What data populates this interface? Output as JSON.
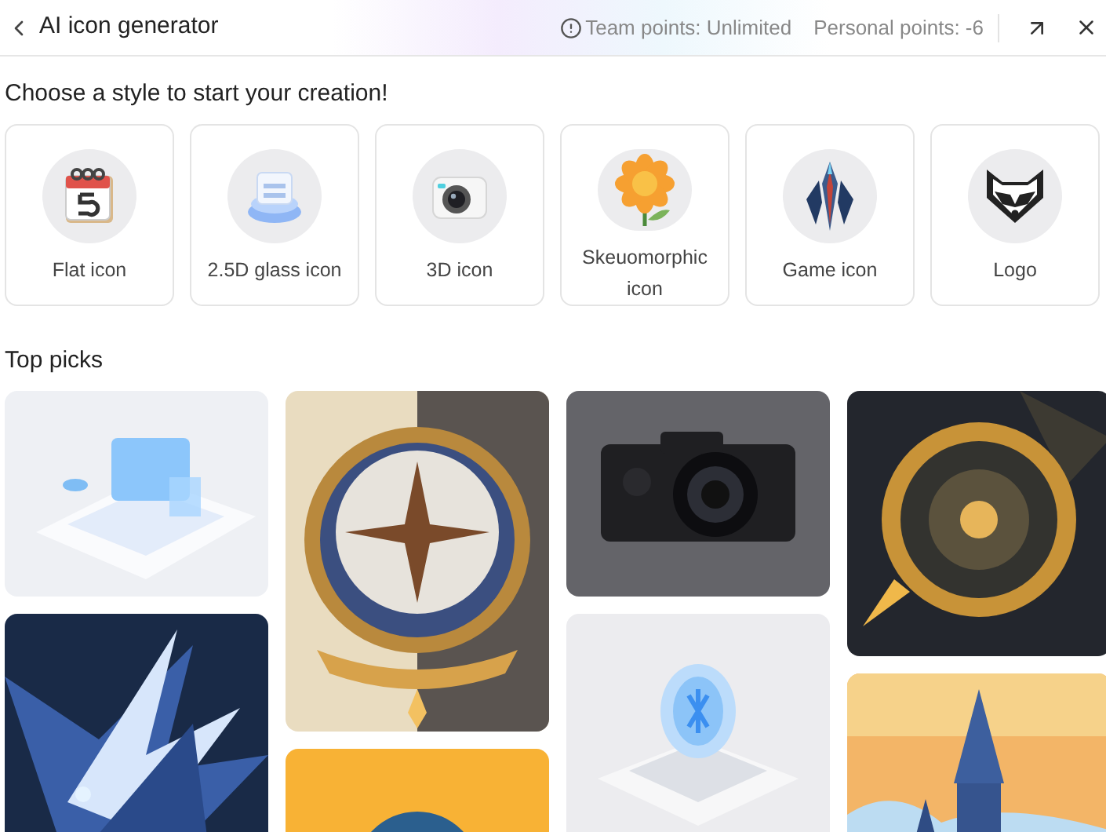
{
  "header": {
    "title": "AI icon generator",
    "team_points": "Team points: Unlimited",
    "personal_points": "Personal points: -6"
  },
  "styles": {
    "heading": "Choose a style to start your creation!",
    "items": [
      {
        "label": "Flat icon",
        "kind": "calendar"
      },
      {
        "label": "2.5D glass icon",
        "kind": "glass"
      },
      {
        "label": "3D icon",
        "kind": "camera"
      },
      {
        "label": "Skeuomorphic icon",
        "kind": "flower"
      },
      {
        "label": "Game icon",
        "kind": "sword"
      },
      {
        "label": "Logo",
        "kind": "raccoon"
      }
    ]
  },
  "top_picks": {
    "title": "Top picks"
  }
}
